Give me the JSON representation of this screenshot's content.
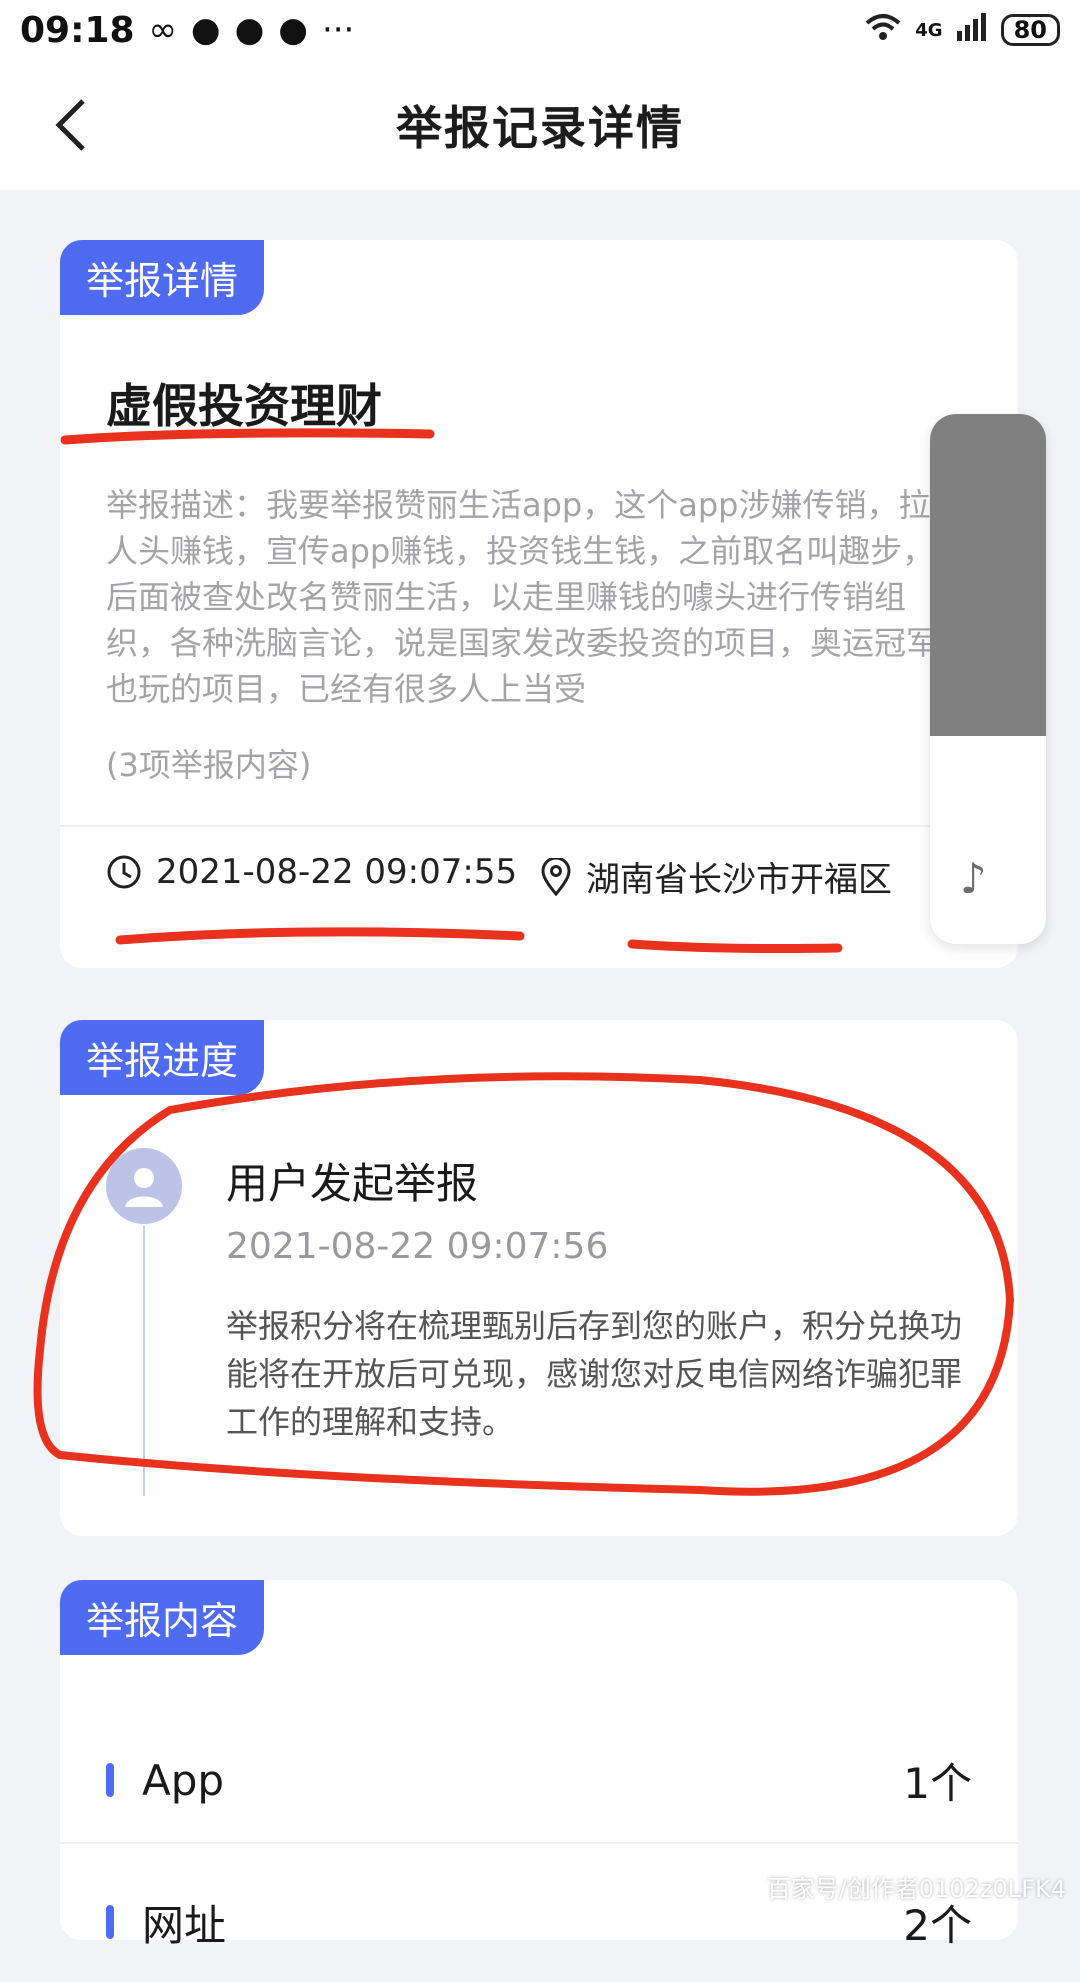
{
  "statusbar": {
    "time": "09:18",
    "network": "4G",
    "battery": "80"
  },
  "header": {
    "title": "举报记录详情"
  },
  "report_detail": {
    "tag": "举报详情",
    "title": "虚假投资理财",
    "description": "举报描述：我要举报赞丽生活app，这个app涉嫌传销，拉人头赚钱，宣传app赚钱，投资钱生钱，之前取名叫趣步，后面被查处改名赞丽生活，以走里赚钱的噱头进行传销组织，各种洗脑言论，说是国家发改委投资的项目，奥运冠军也玩的项目，已经有很多人上当受",
    "count_text": "(3项举报内容)",
    "time": "2021-08-22 09:07:55",
    "location": "湖南省长沙市开福区"
  },
  "progress": {
    "tag": "举报进度",
    "step_title": "用户发起举报",
    "step_time": "2021-08-22 09:07:56",
    "step_desc": "举报积分将在梳理甄别后存到您的账户，积分兑换功能将在开放后可兑现，感谢您对反电信网络诈骗犯罪工作的理解和支持。"
  },
  "report_content": {
    "tag": "举报内容",
    "rows": [
      {
        "label": "App",
        "count": "1个"
      },
      {
        "label": "网址",
        "count": "2个"
      }
    ]
  },
  "float_panel": {
    "icon": "music-note-icon"
  },
  "watermark": "百家号/创作者0102z0LFK4",
  "colors": {
    "accent": "#4f6bf2",
    "annotation": "#e8321e",
    "background": "#f2f3f7"
  }
}
